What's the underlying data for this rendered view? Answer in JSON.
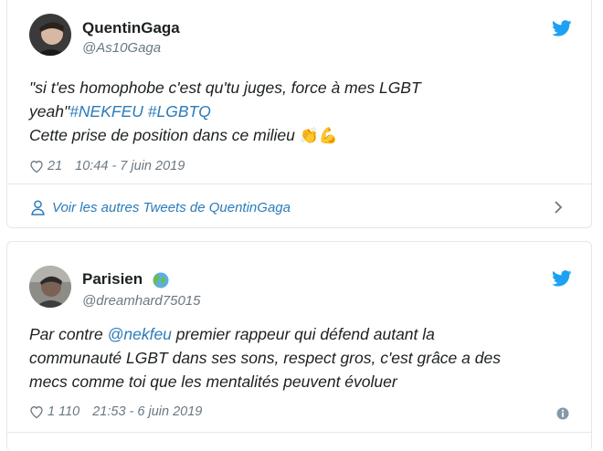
{
  "tweets": [
    {
      "name": "QuentinGaga",
      "handle": "@As10Gaga",
      "text_line1": "\"si t'es homophobe c'est qu'tu juges, force à mes LGBT",
      "text_line2_prefix": "yeah\"",
      "hashtag1": "#NEKFEU",
      "hashtag2": "#LGBTQ",
      "text_line3": "Cette prise de position dans ce milieu",
      "emojis": "👏💪",
      "likes": "21",
      "timestamp": "10:44 - 7 juin 2019",
      "footer_link": "Voir les autres Tweets de QuentinGaga"
    },
    {
      "name": "Parisien",
      "handle": "@dreamhard75015",
      "text_line1_prefix": "Par contre ",
      "mention": "@nekfeu",
      "text_line1_suffix": " premier rappeur qui défend autant la",
      "text_line2": "communauté LGBT dans ses sons, respect gros, c'est grâce a des",
      "text_line3": "mecs comme toi que les mentalités peuvent évoluer",
      "likes": "1 110",
      "timestamp": "21:53 - 6 juin 2019"
    }
  ],
  "colors": {
    "link": "#2b7bb9",
    "muted": "#697882",
    "border": "#e1e8ed",
    "twitter_blue": "#1da1f2"
  },
  "icons": [
    "twitter-bird-icon",
    "heart-icon",
    "person-icon",
    "chevron-right-icon",
    "info-icon",
    "globe-icon"
  ]
}
